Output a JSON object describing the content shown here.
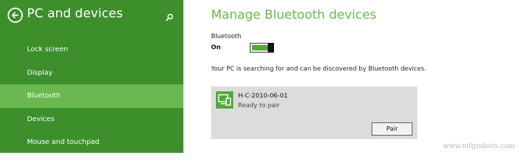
{
  "sidebar": {
    "title": "PC and devices",
    "items": [
      {
        "label": "Lock screen"
      },
      {
        "label": "Display"
      },
      {
        "label": "Bluetooth",
        "active": true
      },
      {
        "label": "Devices"
      },
      {
        "label": "Mouse and touchpad"
      }
    ],
    "icons": {
      "back": "back-arrow-icon",
      "search": "search-icon"
    }
  },
  "main": {
    "title": "Manage Bluetooth devices",
    "bluetooth_label": "Bluetooth",
    "bluetooth_state": "On",
    "status_text": "Your PC is searching for and can be discovered by Bluetooth devices.",
    "device": {
      "name": "H-C-2010-06-01",
      "status": "Ready to pair",
      "pair_label": "Pair",
      "icon": "device-icon"
    }
  },
  "watermark": "www.mfgrobots.com",
  "colors": {
    "sidebar_bg": "#3d8f2c",
    "active_item_bg": "#6ab84f",
    "accent": "#6ab84f",
    "toggle_fill": "#53a83c",
    "card_bg": "#dcdcdc"
  }
}
